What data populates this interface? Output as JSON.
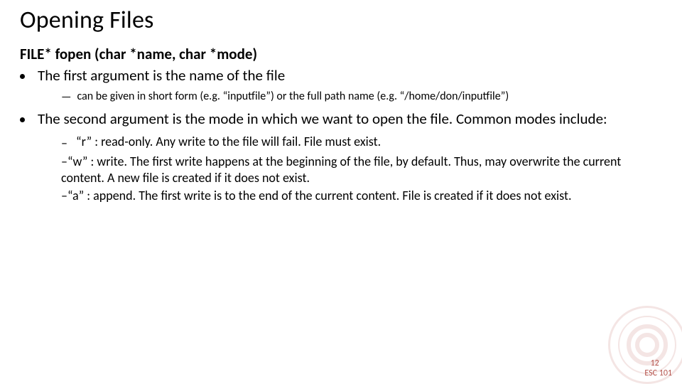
{
  "title": "Opening Files",
  "signature": "FILE* fopen (char *name, char *mode)",
  "bullets": [
    {
      "text": "The first argument is the name of the file",
      "sub": [
        "can be given in short form (e.g. “inputfile”) or the full path name (e.g. “/home/don/inputfile”)"
      ]
    },
    {
      "text": "The second argument is the mode in which we want to open the file. Common modes include:",
      "sub": [
        "“r” : read-only. Any write to the file will fail. File must exist.",
        "“w” : write. The first write happens at the beginning of the file, by default. Thus, may overwrite the current content. A new file is created if it does not exist.",
        "“a” : append. The first write is to the end of the current content. File is created if it does not exist."
      ]
    }
  ],
  "footer": {
    "page": "12",
    "course": "ESC 101"
  }
}
